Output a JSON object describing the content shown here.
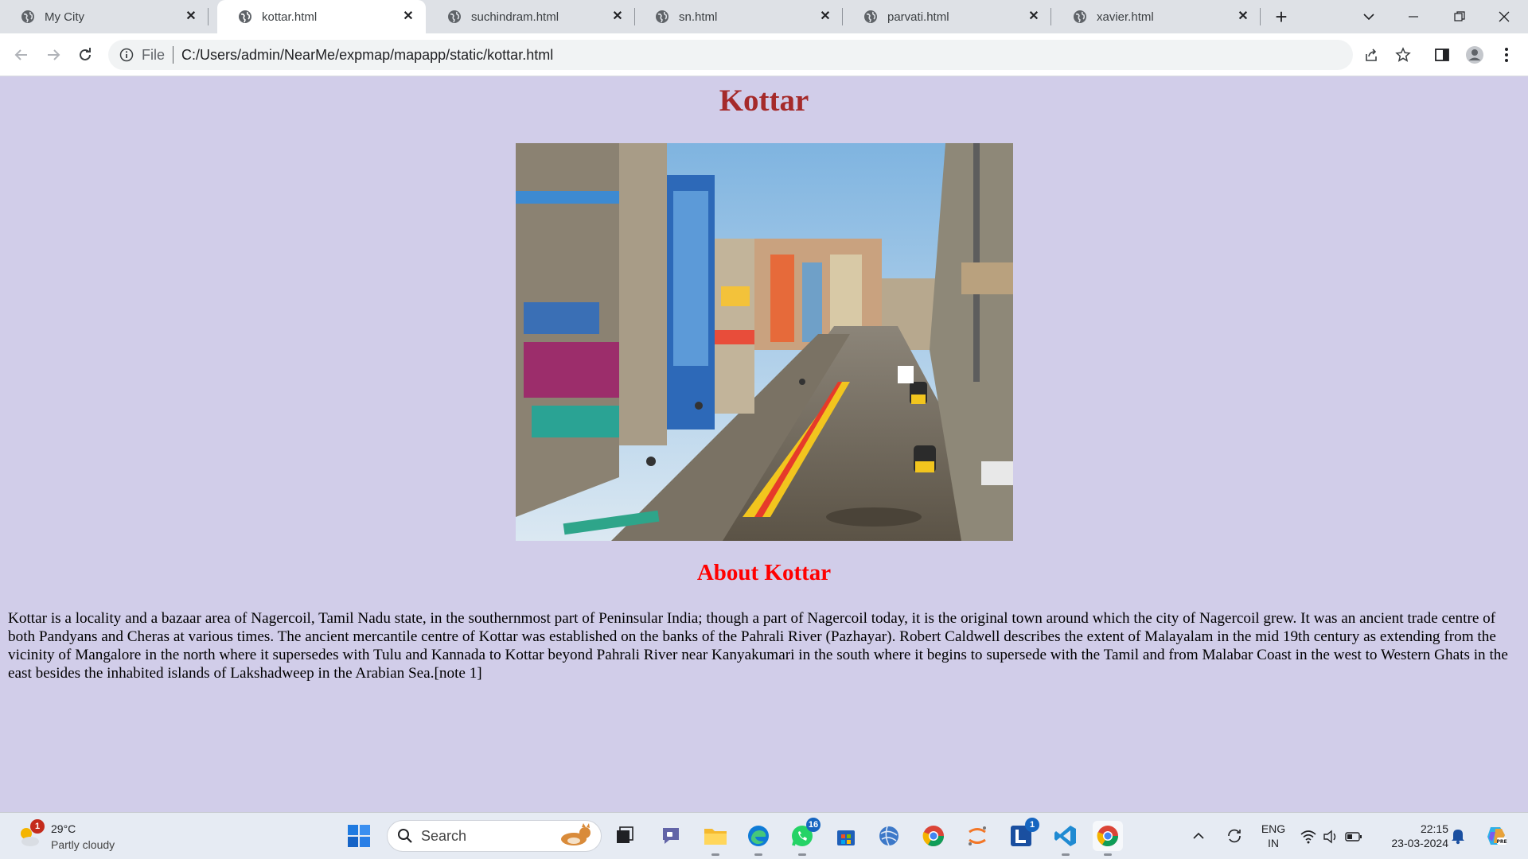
{
  "browser": {
    "tabs": [
      {
        "label": "My City",
        "active": false
      },
      {
        "label": "kottar.html",
        "active": true
      },
      {
        "label": "suchindram.html",
        "active": false
      },
      {
        "label": "sn.html",
        "active": false
      },
      {
        "label": "parvati.html",
        "active": false
      },
      {
        "label": "xavier.html",
        "active": false
      }
    ],
    "address": {
      "scheme_label": "File",
      "url": "C:/Users/admin/NearMe/expmap/mapapp/static/kottar.html"
    }
  },
  "page": {
    "heading": "Kottar",
    "about_heading": "About Kottar",
    "about_text": "Kottar is a locality and a bazaar area of Nagercoil, Tamil Nadu state, in the southernmost part of Peninsular India; though a part of Nagercoil today, it is the original town around which the city of Nagercoil grew. It was an ancient trade centre of both Pandyans and Cheras at various times. The ancient mercantile centre of Kottar was established on the banks of the Pahrali River (Pazhayar). Robert Caldwell describes the extent of Malayalam in the mid 19th century as extending from the vicinity of Mangalore in the north where it supersedes with Tulu and Kannada to Kottar beyond Pahrali River near Kanyakumari in the south where it begins to supersede with the Tamil and from Malabar Coast in the west to Western Ghats in the east besides the inhabited islands of Lakshadweep in the Arabian Sea.[note 1]",
    "heading_color": "#a52a2a",
    "about_heading_color": "#ff0000",
    "background_color": "#d1cde9"
  },
  "taskbar": {
    "weather": {
      "temp": "29°C",
      "condition": "Partly cloudy",
      "badge": "1"
    },
    "search_placeholder": "Search",
    "whatsapp_badge": "16",
    "l_app_badge": "1",
    "language": {
      "line1": "ENG",
      "line2": "IN"
    },
    "clock": {
      "time": "22:15",
      "date": "23-03-2024"
    }
  }
}
